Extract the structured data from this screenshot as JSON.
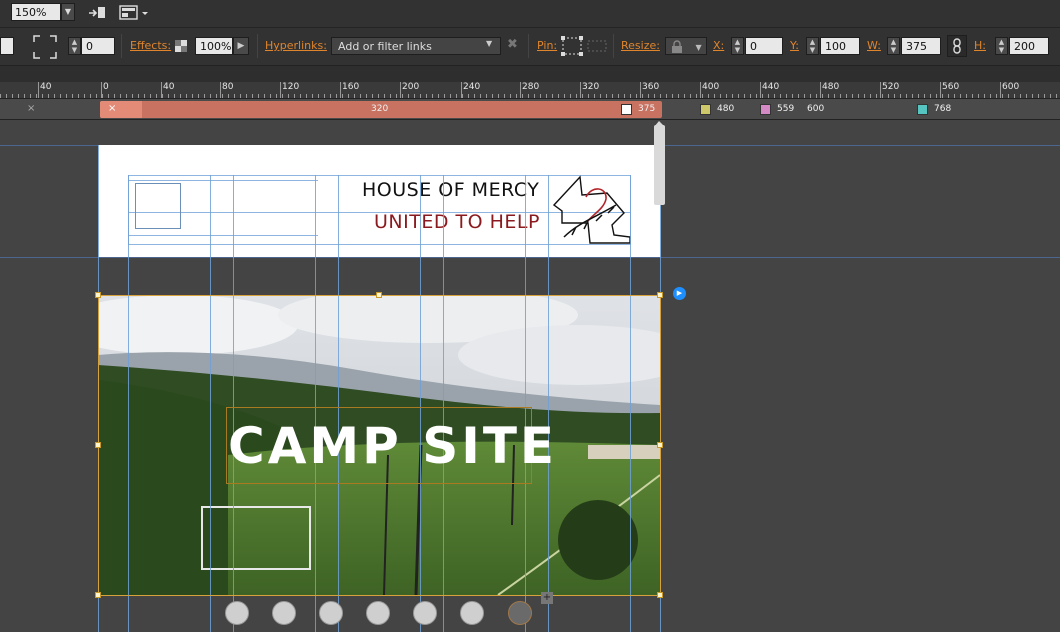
{
  "toolbar": {
    "zoom": "150%"
  },
  "controls": {
    "stroke_value": "0",
    "effects_label": "Effects:",
    "effects_value": "100%",
    "hyperlinks_label": "Hyperlinks:",
    "hyperlinks_placeholder": "Add or filter links",
    "pin_label": "Pin:",
    "resize_label": "Resize:",
    "x_label": "X:",
    "x_value": "0",
    "y_label": "Y:",
    "y_value": "100",
    "w_label": "W:",
    "w_value": "375",
    "h_label": "H:",
    "h_value": "200"
  },
  "ruler": {
    "labels": [
      "40",
      "0",
      "40",
      "80",
      "120",
      "160",
      "200",
      "240",
      "280",
      "320",
      "360",
      "400",
      "440",
      "480",
      "520",
      "560",
      "600"
    ]
  },
  "breakpoints": {
    "range_label": "320",
    "current": "375",
    "bp480": "480",
    "bp559": "559",
    "bp600": "600",
    "bp768": "768",
    "close_left": "×",
    "close_red": "×"
  },
  "header": {
    "title": "HOUSE OF MERCY",
    "subtitle": "UNITED TO HELP"
  },
  "hero": {
    "title": "CAMP SITE"
  },
  "slideshow": {
    "dots": 7,
    "active_index": 6
  },
  "colors": {
    "accent_orange": "#e0852c",
    "breakpoint_red": "#c87262",
    "subtitle_red": "#8a1a1e",
    "guide_blue": "#6fa0d6"
  }
}
